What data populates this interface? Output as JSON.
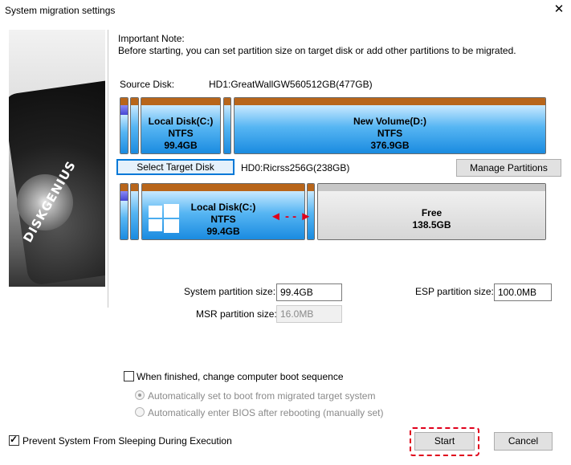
{
  "window": {
    "title": "System migration settings",
    "close_glyph": "✕"
  },
  "sidebar": {
    "brand": "DISKGENIUS"
  },
  "note": {
    "heading": "Important Note:",
    "text": "Before starting, you can set partition size on target disk or add other partitions to be migrated."
  },
  "source": {
    "label": "Source Disk:",
    "value": "HD1:GreatWallGW560512GB(477GB)",
    "partitions": [
      {
        "name": "",
        "fs": "",
        "size": ""
      },
      {
        "name": "",
        "fs": "",
        "size": ""
      },
      {
        "name": "Local Disk(C:)",
        "fs": "NTFS",
        "size": "99.4GB"
      },
      {
        "name": "",
        "fs": "",
        "size": ""
      },
      {
        "name": "New Volume(D:)",
        "fs": "NTFS",
        "size": "376.9GB"
      }
    ]
  },
  "target": {
    "select_button": "Select Target Disk",
    "value": "HD0:Ricrss256G(238GB)",
    "manage_button": "Manage Partitions",
    "partitions": [
      {
        "name": "",
        "fs": "",
        "size": ""
      },
      {
        "name": "",
        "fs": "",
        "size": ""
      },
      {
        "name": "Local Disk(C:)",
        "fs": "NTFS",
        "size": "99.4GB"
      },
      {
        "name": "",
        "fs": "",
        "size": ""
      },
      {
        "name": "Free",
        "fs": "",
        "size": "138.5GB"
      }
    ],
    "resize_arrow": "◄ - - ►"
  },
  "fields": {
    "system_size_label": "System partition size:",
    "system_size_value": "99.4GB",
    "esp_size_label": "ESP partition size:",
    "esp_size_value": "100.0MB",
    "msr_size_label": "MSR partition size:",
    "msr_size_value": "16.0MB"
  },
  "options": {
    "change_boot_label": "When finished, change computer boot sequence",
    "change_boot_checked": false,
    "auto_boot_label": "Automatically set to boot from migrated target system",
    "enter_bios_label": "Automatically enter BIOS after rebooting (manually set)",
    "prevent_sleep_label": "Prevent System From Sleeping During Execution",
    "prevent_sleep_checked": true
  },
  "buttons": {
    "start": "Start",
    "cancel": "Cancel"
  },
  "colors": {
    "accent": "#0078d7",
    "highlight": "#e0001b",
    "partition_brown": "#b8651a",
    "partition_blue": "#1a8be0"
  }
}
